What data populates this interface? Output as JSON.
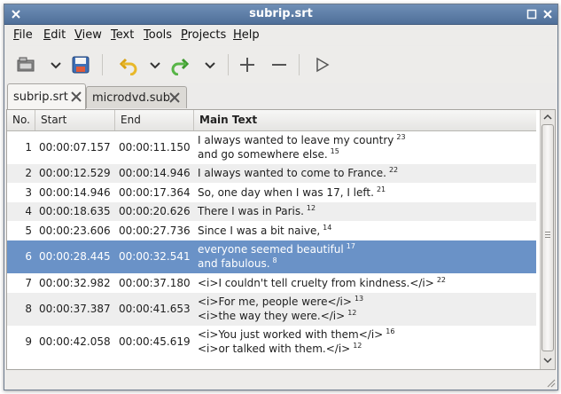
{
  "window": {
    "title": "subrip.srt"
  },
  "menu": [
    {
      "mnemonic": "F",
      "rest": "ile"
    },
    {
      "mnemonic": "E",
      "rest": "dit"
    },
    {
      "mnemonic": "V",
      "rest": "iew"
    },
    {
      "mnemonic": "T",
      "rest": "ext"
    },
    {
      "mnemonic": "T",
      "rest": "ools"
    },
    {
      "mnemonic": "P",
      "rest": "rojects"
    },
    {
      "mnemonic": "H",
      "rest": "elp"
    }
  ],
  "toolbar": {
    "icons": [
      "open-icon",
      "dropdown-icon",
      "save-icon",
      "undo-icon",
      "dropdown-icon",
      "redo-icon",
      "dropdown-icon",
      "add-icon",
      "remove-icon",
      "play-icon"
    ]
  },
  "tabs": [
    {
      "label": "subrip.srt",
      "active": true
    },
    {
      "label": "microdvd.sub",
      "active": false
    }
  ],
  "table": {
    "headers": {
      "no": "No.",
      "start": "Start",
      "end": "End",
      "text": "Main Text"
    },
    "rows": [
      {
        "no": "1",
        "start": "00:00:07.157",
        "end": "00:00:11.150",
        "line1": "I always wanted to leave my country",
        "sup1": "23",
        "line2": "and go somewhere else.",
        "sup2": "15"
      },
      {
        "no": "2",
        "start": "00:00:12.529",
        "end": "00:00:14.946",
        "line1": "I always wanted to come to France.",
        "sup1": "22"
      },
      {
        "no": "3",
        "start": "00:00:14.946",
        "end": "00:00:17.364",
        "line1": "So, one day when I was 17, I left.",
        "sup1": "21"
      },
      {
        "no": "4",
        "start": "00:00:18.635",
        "end": "00:00:20.626",
        "line1": "There I was in Paris.",
        "sup1": "12"
      },
      {
        "no": "5",
        "start": "00:00:23.606",
        "end": "00:00:27.736",
        "line1": "Since I was a bit naive,",
        "sup1": "14"
      },
      {
        "no": "6",
        "start": "00:00:28.445",
        "end": "00:00:32.541",
        "line1": "everyone seemed beautiful",
        "sup1": "17",
        "line2": "and fabulous.",
        "sup2": "8"
      },
      {
        "no": "7",
        "start": "00:00:32.982",
        "end": "00:00:37.180",
        "line1": "<i>I couldn't tell cruelty from kindness.</i>",
        "sup1": "22"
      },
      {
        "no": "8",
        "start": "00:00:37.387",
        "end": "00:00:41.653",
        "line1": "<i>For me, people were</i>",
        "sup1": "13",
        "line2": "<i>the way they were.</i>",
        "sup2": "12"
      },
      {
        "no": "9",
        "start": "00:00:42.058",
        "end": "00:00:45.619",
        "line1": "<i>You just worked with them</i>",
        "sup1": "16",
        "line2": "<i>or talked with them.</i>",
        "sup2": "12"
      }
    ],
    "selected_row": "6"
  },
  "colors": {
    "titlebar": "#5f80aa",
    "selection": "#6a92c7",
    "alt_row": "#eeeeee"
  }
}
